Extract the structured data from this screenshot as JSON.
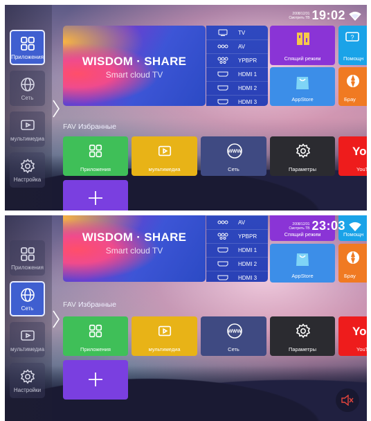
{
  "screens": [
    {
      "status": {
        "date_top": "2008/12/31",
        "date_bottom": "Смотреть ТВ",
        "time": "19:02"
      },
      "sidebar": [
        {
          "label": "Приложения",
          "state": "active"
        },
        {
          "label": "Сеть",
          "state": "dim"
        },
        {
          "label": "мультимедиа",
          "state": "dim"
        },
        {
          "label": "Настройка",
          "state": "dim"
        }
      ]
    },
    {
      "status": {
        "date_top": "2008/12/31",
        "date_bottom": "Смотреть ТВ",
        "time": "23:03"
      },
      "sidebar": [
        {
          "label": "Приложения",
          "state": "dim"
        },
        {
          "label": "Сеть",
          "state": "active"
        },
        {
          "label": "мультимедиа",
          "state": "dim"
        },
        {
          "label": "Настройки",
          "state": "dim"
        }
      ]
    }
  ],
  "hero": {
    "title_left": "WISDOM",
    "title_sep": " · ",
    "title_right": "SHARE",
    "subtitle": "Smart cloud TV"
  },
  "sources": [
    "TV",
    "AV",
    "YPBPR",
    "HDMI 1",
    "HDMI 2",
    "HDMI 3"
  ],
  "app_tiles": {
    "sleep": "Спящий режим",
    "help": "Помощн",
    "appstore": "AppStore",
    "browser": "Брау"
  },
  "favorites": {
    "heading_prefix": "FAV",
    "heading": "Избранные",
    "items": [
      "Приложения",
      "мультимедиа",
      "Сеть",
      "Параметры",
      "YouT"
    ]
  },
  "youtube_logo": "You",
  "colors": {
    "tile_green": "#3fbf58",
    "tile_yellow": "#e8b317",
    "tile_network": "#3f4a82",
    "tile_settings": "#2b2b30",
    "tile_youtube": "#ee1c1c",
    "tile_add": "#7a3fe0",
    "tile_sleep": "#8a34d6",
    "tile_appstore": "#3c8ee8",
    "tile_orange": "#f07a22",
    "accent_blue": "#3f5fd0"
  }
}
